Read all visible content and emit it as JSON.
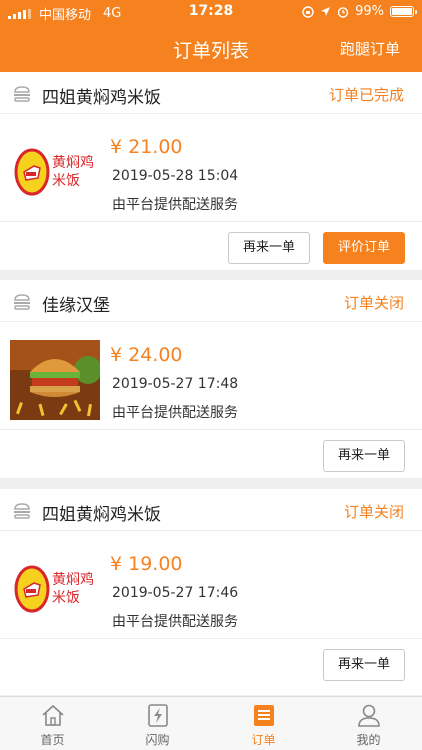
{
  "status_bar": {
    "carrier": "中国移动",
    "network": "4G",
    "time": "17:28",
    "battery": "99%",
    "battery_level": 0.99
  },
  "nav": {
    "title": "订单列表",
    "right_action": "跑腿订单"
  },
  "orders": [
    {
      "shop": "四姐黄焖鸡米饭",
      "status": "订单已完成",
      "price": "¥ 21.00",
      "time": "2019-05-28 15:04",
      "delivery": "由平台提供配送服务",
      "logo_text": [
        "黄焖鸡",
        "米饭"
      ],
      "buttons": [
        "再来一单",
        "评价订单"
      ]
    },
    {
      "shop": "佳缘汉堡",
      "status": "订单关闭",
      "price": "¥ 24.00",
      "time": "2019-05-27 17:48",
      "delivery": "由平台提供配送服务",
      "buttons": [
        "再来一单"
      ]
    },
    {
      "shop": "四姐黄焖鸡米饭",
      "status": "订单关闭",
      "price": "¥ 19.00",
      "time": "2019-05-27 17:46",
      "delivery": "由平台提供配送服务",
      "logo_text": [
        "黄焖鸡",
        "米饭"
      ],
      "buttons": [
        "再来一单"
      ]
    }
  ],
  "tabs": [
    {
      "label": "首页",
      "icon": "home-icon"
    },
    {
      "label": "闪购",
      "icon": "flash-icon"
    },
    {
      "label": "订单",
      "icon": "orders-icon",
      "active": true
    },
    {
      "label": "我的",
      "icon": "profile-icon"
    }
  ],
  "colors": {
    "accent": "#f5821f",
    "background": "#efefef",
    "logo_red": "#d9262b",
    "logo_yellow": "#f6d21e"
  }
}
